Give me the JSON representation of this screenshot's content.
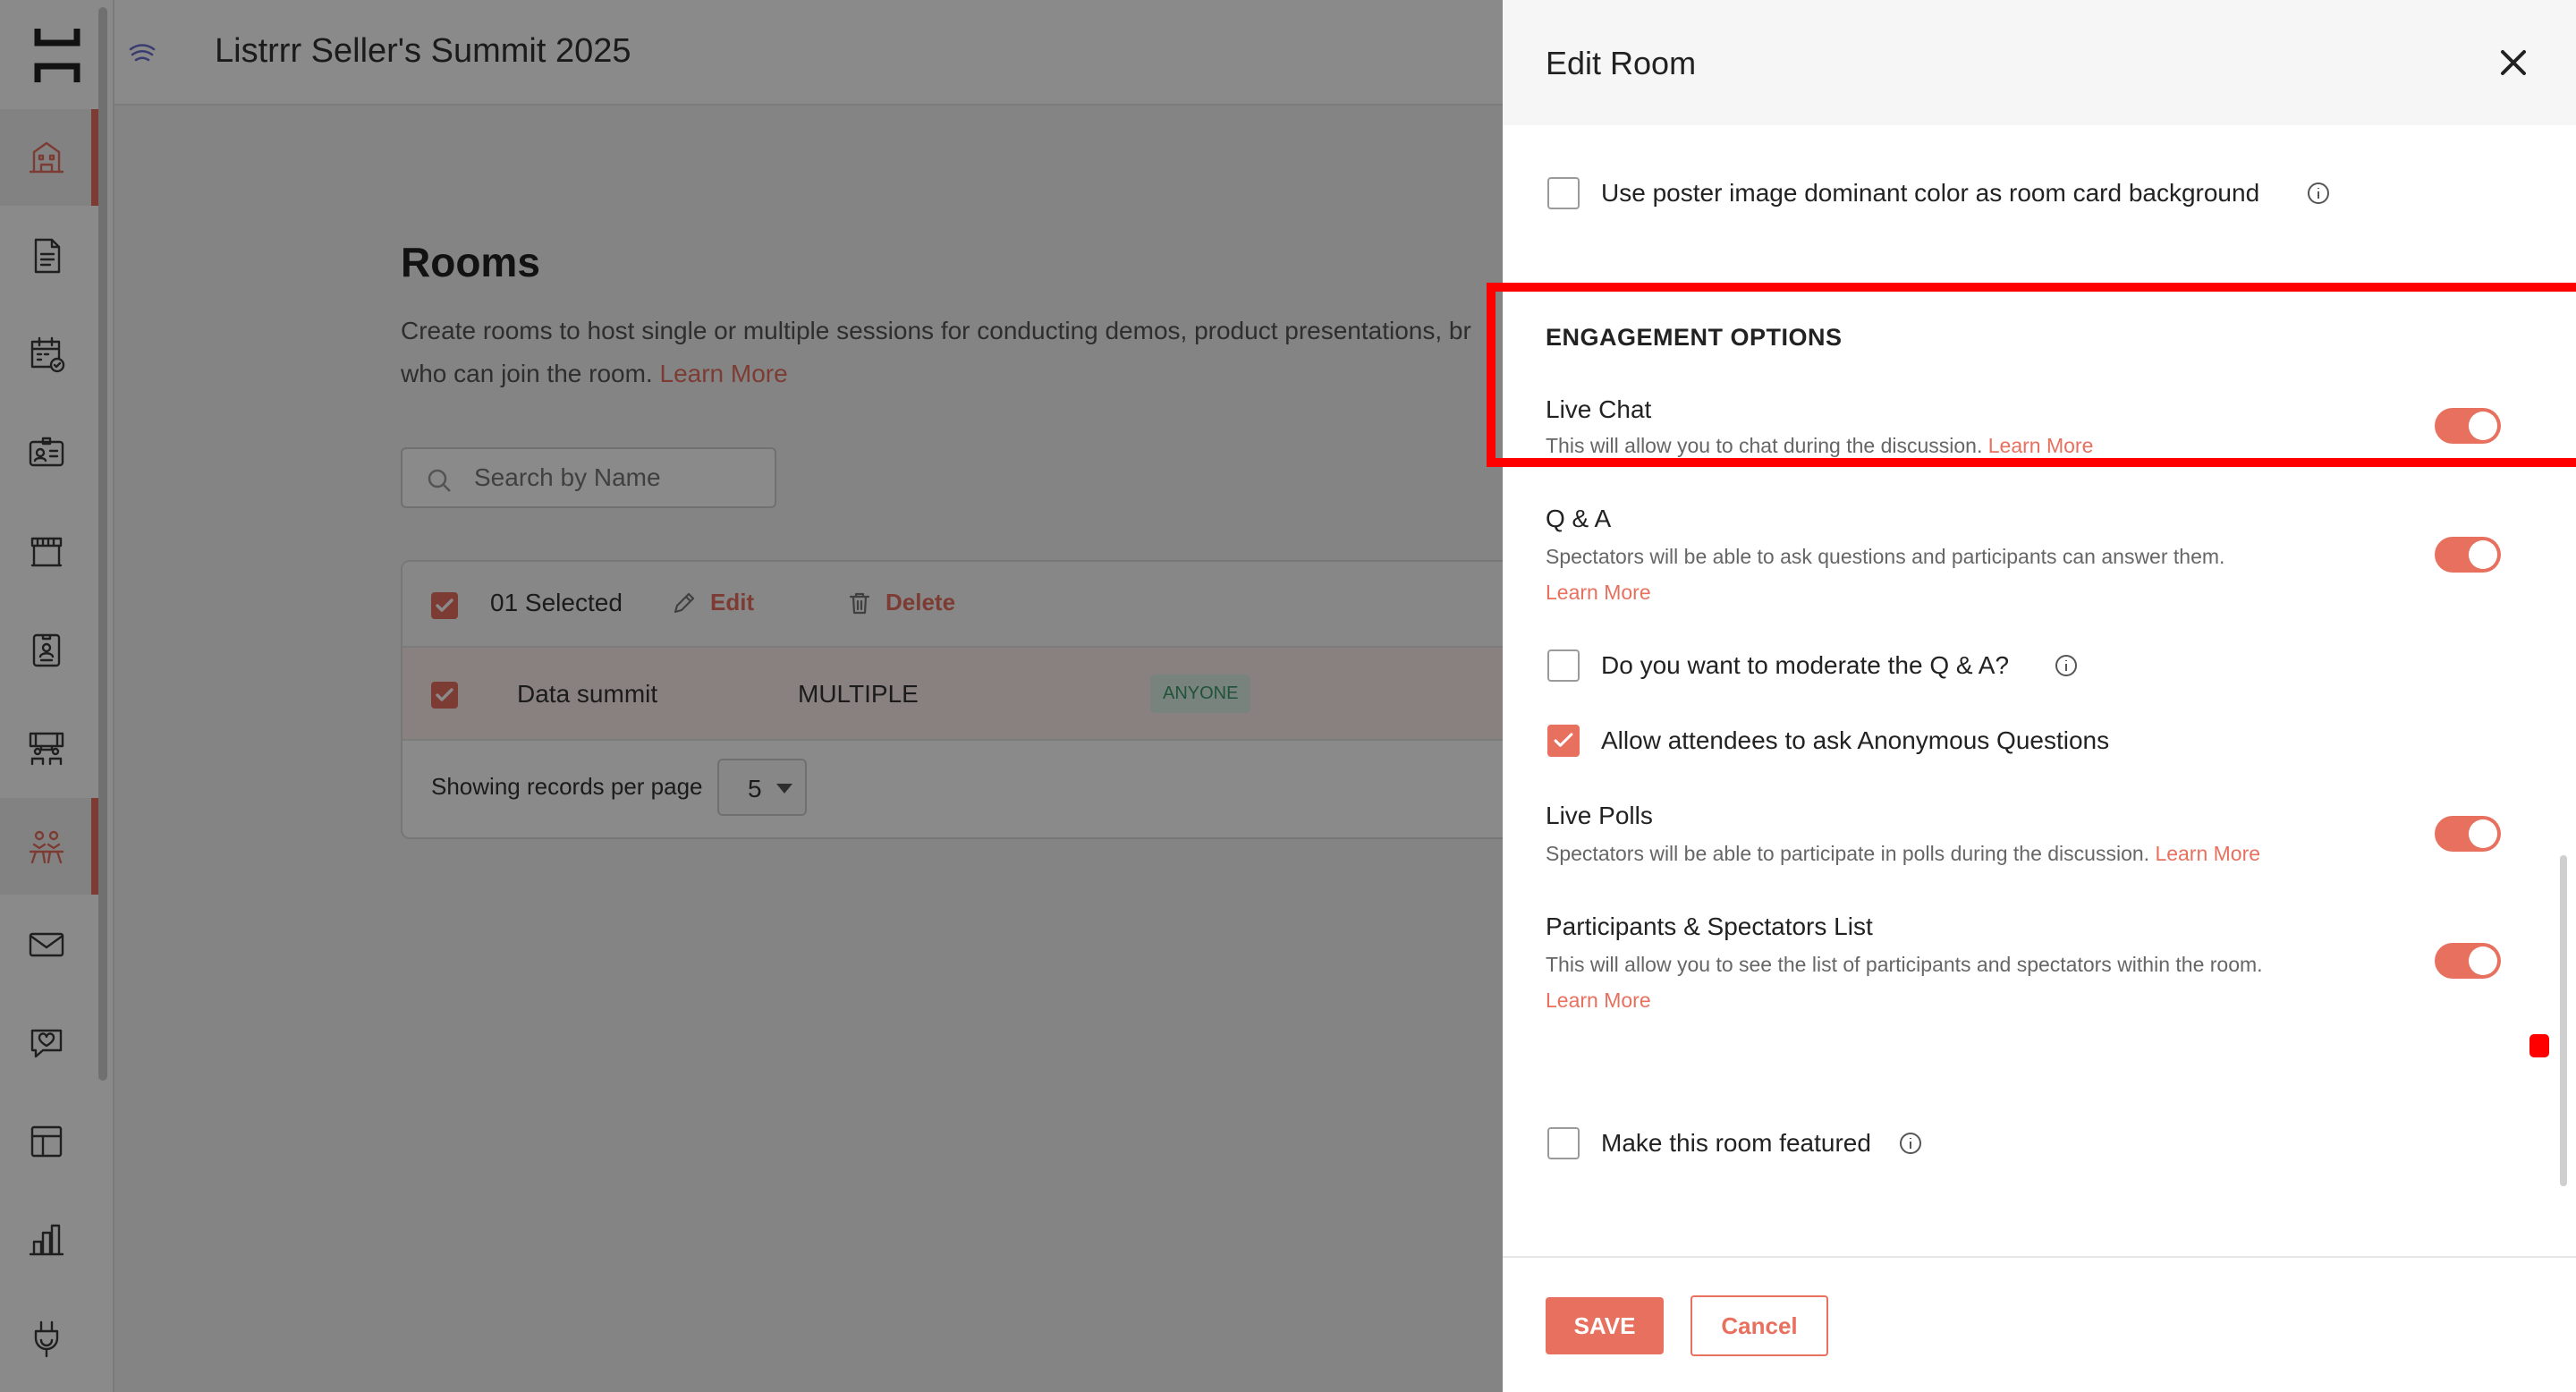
{
  "topbar": {
    "event_title": "Listrrr Seller's Summit 2025",
    "brand_icon": "listrrr-logo-icon"
  },
  "sidebar": {
    "items": [
      {
        "icon": "venue-icon",
        "active": true
      },
      {
        "icon": "document-icon"
      },
      {
        "icon": "calendar-check-icon"
      },
      {
        "icon": "badge-id-icon"
      },
      {
        "icon": "booth-icon"
      },
      {
        "icon": "speaker-card-icon"
      },
      {
        "icon": "lounge-icon"
      },
      {
        "icon": "rooms-icon",
        "active": true
      },
      {
        "icon": "mail-icon"
      },
      {
        "icon": "chat-heart-icon"
      },
      {
        "icon": "layout-icon"
      },
      {
        "icon": "analytics-icon"
      },
      {
        "icon": "plug-icon"
      }
    ]
  },
  "main": {
    "title": "Rooms",
    "description": "Create rooms to host single or multiple sessions for conducting demos, product presentations, br",
    "description_line2": "who can join the room.",
    "learn_more": "Learn More",
    "search": {
      "placeholder": "Search by Name"
    },
    "table": {
      "selected_count": "01 Selected",
      "edit_label": "Edit",
      "delete_label": "Delete",
      "rows": [
        {
          "name": "Data summit",
          "type": "MULTIPLE",
          "access": "ANYONE",
          "checked": true
        }
      ],
      "per_page_label": "Showing records per page",
      "per_page_value": "5"
    }
  },
  "drawer": {
    "title": "Edit Room",
    "poster_color_option": {
      "label": "Use poster image dominant color as room card background",
      "checked": false
    },
    "section_title": "ENGAGEMENT OPTIONS",
    "live_chat": {
      "title": "Live Chat",
      "desc": "This will allow you to chat during the discussion.",
      "link": "Learn More",
      "enabled": true
    },
    "qa": {
      "title": "Q & A",
      "desc": "Spectators will be able to ask questions and participants can answer them.",
      "link": "Learn More",
      "enabled": true
    },
    "moderate_qa": {
      "label": "Do you want to moderate the Q & A?",
      "checked": false
    },
    "anonymous_q": {
      "label": "Allow attendees to ask Anonymous Questions",
      "checked": true
    },
    "live_polls": {
      "title": "Live Polls",
      "desc": "Spectators will be able to participate in polls during the discussion.",
      "link": "Learn More",
      "enabled": true
    },
    "participants_list": {
      "title": "Participants & Spectators List",
      "desc": "This will allow you to see the list of participants and spectators within the room.",
      "link": "Learn More",
      "enabled": true
    },
    "featured": {
      "label": "Make this room featured",
      "checked": false
    },
    "save_label": "SAVE",
    "cancel_label": "Cancel"
  },
  "colors": {
    "accent": "#e8705f",
    "highlight": "#ff0000",
    "badge_green": "#3b9a6b"
  }
}
